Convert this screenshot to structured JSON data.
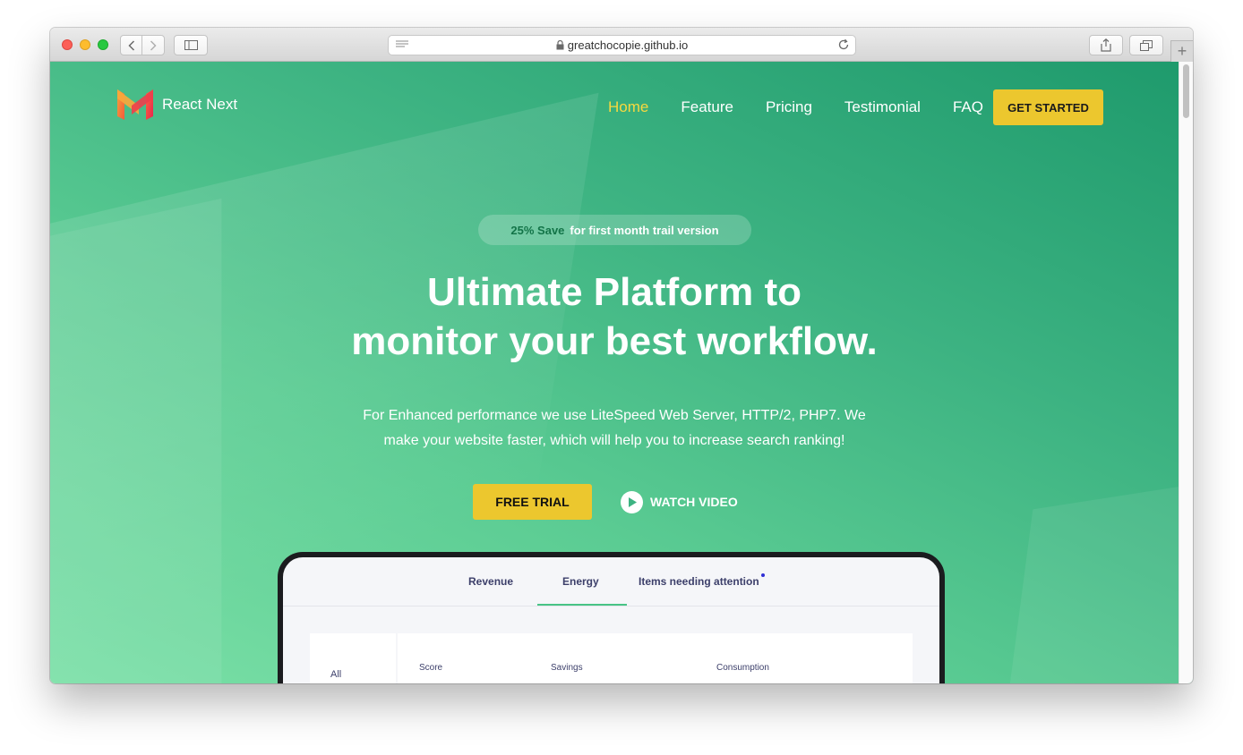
{
  "browser": {
    "url": "greatchocopie.github.io"
  },
  "header": {
    "brand": "React Next",
    "nav": [
      {
        "label": "Home",
        "active": true
      },
      {
        "label": "Feature",
        "active": false
      },
      {
        "label": "Pricing",
        "active": false
      },
      {
        "label": "Testimonial",
        "active": false
      },
      {
        "label": "FAQ",
        "active": false
      }
    ],
    "cta": "GET STARTED"
  },
  "hero": {
    "badge_highlight": "25% Save",
    "badge_text": "for first month trail version",
    "title_line1": "Ultimate Platform to",
    "title_line2": "monitor your best workflow.",
    "description": "For Enhanced performance we use LiteSpeed Web Server, HTTP/2, PHP7. We make your website faster, which will help you to increase search ranking!",
    "primary_button": "FREE TRIAL",
    "video_button": "WATCH VIDEO"
  },
  "dashboard": {
    "tabs": [
      "Revenue",
      "Energy",
      "Items needing attention"
    ],
    "active_tab": "Energy",
    "filter_label": "All",
    "stats": [
      "Score",
      "Savings",
      "Consumption"
    ]
  },
  "colors": {
    "accent_yellow": "#ecc72e",
    "active_nav": "#f7d93f",
    "hero_green": "#3db382"
  }
}
